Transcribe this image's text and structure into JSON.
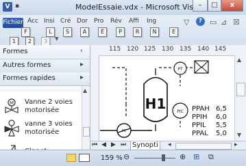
{
  "window": {
    "title": "ModelEssaie.vdx - Microsoft Visio",
    "app_icon": "V",
    "minimize": "–",
    "maximize": "□",
    "close": "x"
  },
  "ribbon": {
    "file_tab": "Fichier",
    "tabs": [
      "Acc",
      "Insi",
      "Cré",
      "Dor",
      "Pro",
      "Rév",
      "Affi",
      "Ing"
    ],
    "keytips_top": [
      "F",
      "L",
      "S",
      "A",
      "É",
      "P",
      "R",
      "N",
      "E"
    ],
    "keytips_bottom": [
      "1",
      "2",
      "3"
    ],
    "help": "?"
  },
  "shapes_pane": {
    "title": "Formes",
    "stencils": [
      "Autres formes",
      "Formes rapides"
    ],
    "items": [
      {
        "label_line1": "Vanne 2 voies",
        "label_line2": "motorisée",
        "icon": "valve-2way-motor-icon"
      },
      {
        "label_line1": "vanne 3 voies",
        "label_line2": "motorisée",
        "icon": "valve-3way-motor-icon"
      },
      {
        "label_line1": "Clapet",
        "label_line2": "",
        "icon": "check-valve-icon"
      }
    ]
  },
  "ruler": {
    "ticks": [
      "115",
      "120",
      "125",
      "130",
      "135",
      "140",
      "145"
    ]
  },
  "drawing": {
    "tank_label": "H1",
    "pt_label": "PT",
    "pic_label": "PIC",
    "pump_label": "FC",
    "alarms": [
      {
        "name": "PPAH",
        "value": "6,5"
      },
      {
        "name": "PPIH",
        "value": "6,0"
      },
      {
        "name": "PPIL",
        "value": "5,5"
      },
      {
        "name": "PPAL",
        "value": "5,0"
      }
    ]
  },
  "pagebar": {
    "page_tab": "Synopti"
  },
  "status": {
    "zoom": "159 %"
  }
}
